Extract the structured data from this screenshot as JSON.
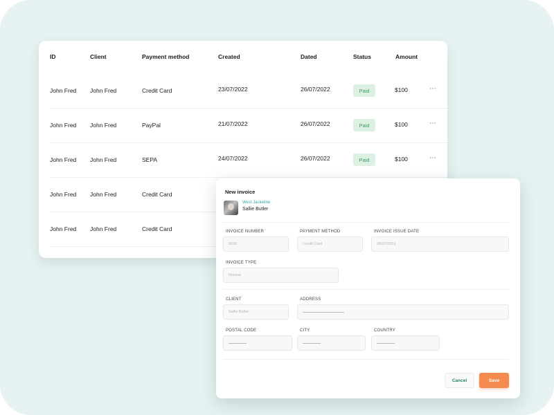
{
  "table": {
    "headers": {
      "id": "ID",
      "client": "Client",
      "payment_method": "Payment method",
      "created": "Created",
      "dated": "Dated",
      "status": "Status",
      "amount": "Amount"
    },
    "rows": [
      {
        "id": "John Fred",
        "client": "John Fred",
        "payment_method": "Credit Card",
        "created": "23/07/2022",
        "dated": "26/07/2022",
        "status": "Paid",
        "amount": "$100"
      },
      {
        "id": "John Fred",
        "client": "John Fred",
        "payment_method": "PayPal",
        "created": "21/07/2022",
        "dated": "26/07/2022",
        "status": "Paid",
        "amount": "$100"
      },
      {
        "id": "John Fred",
        "client": "John Fred",
        "payment_method": "SEPA",
        "created": "24/07/2022",
        "dated": "26/07/2022",
        "status": "Paid",
        "amount": "$100"
      },
      {
        "id": "John Fred",
        "client": "John Fred",
        "payment_method": "Credit Card"
      },
      {
        "id": "John Fred",
        "client": "John Fred",
        "payment_method": "Credit Card"
      }
    ],
    "more_icon": "⋯"
  },
  "modal": {
    "title": "New invoice",
    "user": {
      "org": "West Jackeline",
      "name": "Sallie Butler"
    },
    "fields": {
      "invoice_number": {
        "label": "INVOICE NUMBER",
        "value": "0000"
      },
      "payment_method": {
        "label": "PAYMENT METHOD",
        "value": "Credit Card"
      },
      "issue_date": {
        "label": "INVOICE ISSUE DATE",
        "value": "28/07/2022"
      },
      "invoice_type": {
        "label": "INVOICE TYPE",
        "value": "Normal"
      },
      "client": {
        "label": "CLIENT",
        "value": "Sallie Butler"
      },
      "address": {
        "label": "ADDRESS"
      },
      "postal_code": {
        "label": "POSTAL CODE"
      },
      "city": {
        "label": "CITY"
      },
      "country": {
        "label": "COUNTRY"
      }
    },
    "buttons": {
      "cancel": "Cancel",
      "save": "Save"
    }
  },
  "colors": {
    "background": "#e6f3f2",
    "paid_badge_bg": "#dcf1e3",
    "paid_badge_text": "#3b9b5c",
    "accent_teal": "#3aa6a8",
    "cancel_text": "#2a7f6d",
    "save_button": "#f48a4e"
  }
}
